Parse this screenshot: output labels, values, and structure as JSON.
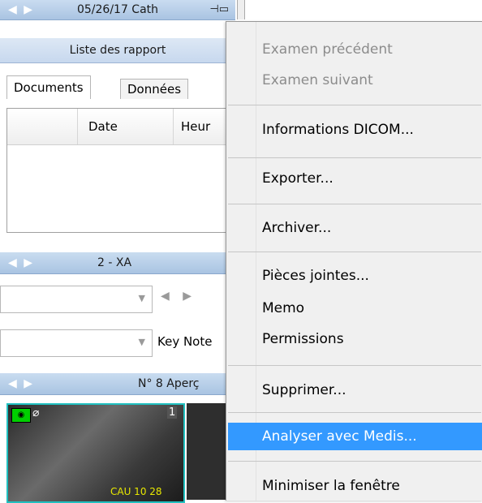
{
  "top_bar": {
    "nav": "◀ ▶",
    "title": "05/26/17 Cath",
    "pin_icon": "pin-icon"
  },
  "reports_bar": {
    "title": "Liste des rapport"
  },
  "tabs": {
    "documents": "Documents",
    "donnees": "Données"
  },
  "table": {
    "col_date": "Date",
    "col_heure": "Heur"
  },
  "series_bar": {
    "nav": "◀ ▶",
    "title": "2 - XA"
  },
  "controls": {
    "key_note": "Key Note",
    "nav_arrows": "◀ ▶"
  },
  "preview_bar": {
    "nav": "◀ ▶",
    "title": "N° 8 Aperç"
  },
  "thumbnail": {
    "number": "1",
    "overlay_text": "CAU 10 28"
  },
  "menu": {
    "items": [
      {
        "label": "Examen précédent",
        "disabled": true
      },
      {
        "label": "Examen suivant",
        "disabled": true
      },
      {
        "label": "Informations DICOM..."
      },
      {
        "label": "Exporter..."
      },
      {
        "label": "Archiver..."
      },
      {
        "label": "Pièces jointes..."
      },
      {
        "label": "Memo"
      },
      {
        "label": "Permissions"
      },
      {
        "label": "Supprimer..."
      },
      {
        "label": "Analyser avec Medis...",
        "highlighted": true
      },
      {
        "label": "Minimiser la fenêtre"
      }
    ]
  },
  "colors": {
    "highlight": "#3399ff",
    "header_blue": "#a9c4e2",
    "thumb_border": "#20c0c0"
  }
}
